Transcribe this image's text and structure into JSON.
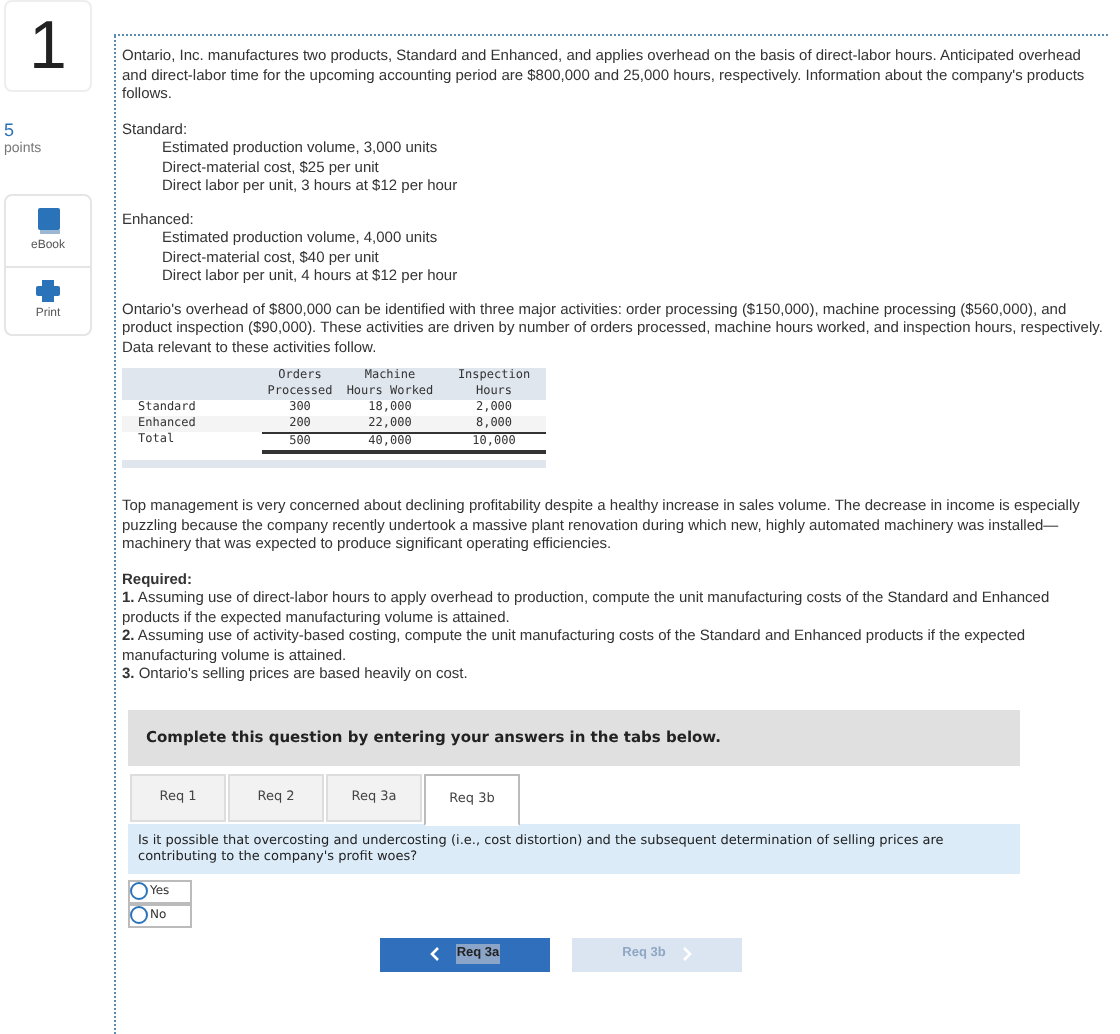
{
  "question_number": "1",
  "points": {
    "value": "5",
    "label": "points"
  },
  "tools": [
    {
      "kind": "ebook",
      "label": "eBook"
    },
    {
      "kind": "print",
      "label": "Print"
    }
  ],
  "intro": "Ontario, Inc. manufactures two products, Standard and Enhanced, and applies overhead on the basis of direct-labor hours. Anticipated overhead and direct-labor time for the upcoming accounting period are $800,000 and 25,000 hours, respectively. Information about the company's products follows.",
  "products": [
    {
      "name": "Standard:",
      "lines": [
        "Estimated production volume, 3,000 units",
        "Direct-material cost, $25 per unit",
        "Direct labor per unit, 3 hours at $12 per hour"
      ]
    },
    {
      "name": "Enhanced:",
      "lines": [
        "Estimated production volume, 4,000 units",
        "Direct-material cost, $40 per unit",
        "Direct labor per unit, 4 hours at $12 per hour"
      ]
    }
  ],
  "overhead_text": "Ontario's overhead of $800,000 can be identified with three major activities: order processing ($150,000), machine processing ($560,000), and product inspection ($90,000). These activities are driven by number of orders processed, machine hours worked, and inspection hours, respectively. Data relevant to these activities follow.",
  "table": {
    "header_rows": [
      [
        "Orders",
        "Machine",
        "Inspection"
      ],
      [
        "Processed",
        "Hours Worked",
        "Hours"
      ]
    ],
    "rows": [
      {
        "kind": "data",
        "label": "Standard",
        "cells": [
          "300",
          "18,000",
          "2,000"
        ]
      },
      {
        "kind": "data",
        "label": "Enhanced",
        "cells": [
          "200",
          "22,000",
          "8,000"
        ]
      },
      {
        "kind": "total",
        "label": "Total",
        "cells": [
          "500",
          "40,000",
          "10,000"
        ]
      }
    ]
  },
  "concern_text": "Top management is very concerned about declining profitability despite a healthy increase in sales volume. The decrease in income is especially puzzling because the company recently undertook a massive plant renovation during which new, highly automated machinery was installed—machinery that was expected to produce significant operating efficiencies.",
  "required_title": "Required:",
  "required": [
    "**1.** Assuming use of direct-labor hours to apply overhead to production, compute the unit manufacturing costs of the Standard and Enhanced products if the expected manufacturing volume is attained.",
    "**2.** Assuming use of activity-based costing, compute the unit manufacturing costs of the Standard and Enhanced products if the expected manufacturing volume is attained.",
    "**3.** Ontario's selling prices are based heavily on cost."
  ],
  "instruction": "Complete this question by entering your answers in the tabs below.",
  "tabs": [
    {
      "label": "Req 1",
      "selected": false
    },
    {
      "label": "Req 2",
      "selected": false
    },
    {
      "label": "Req 3a",
      "selected": false
    },
    {
      "label": "Req 3b",
      "selected": true
    }
  ],
  "prompt": "Is it possible that overcosting and undercosting (i.e., cost distortion) and the subsequent determination of selling prices are contributing to the company's profit woes?",
  "options": [
    {
      "label": "Yes",
      "selected": false
    },
    {
      "label": "No",
      "selected": false
    }
  ],
  "nav": {
    "prev": {
      "label": "Req 3a",
      "disabled": false
    },
    "next": {
      "label": "Req 3b",
      "disabled": true
    }
  }
}
